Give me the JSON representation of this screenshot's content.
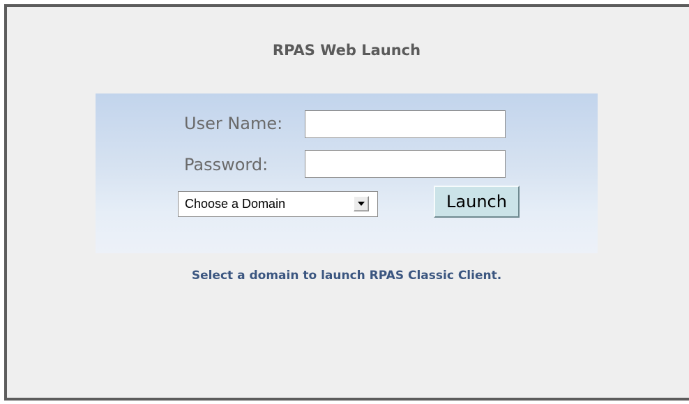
{
  "page": {
    "title": "RPAS Web Launch",
    "hint": "Select a domain to launch RPAS Classic Client."
  },
  "form": {
    "user_label": "User Name:",
    "user_value": "",
    "password_label": "Password:",
    "password_value": "",
    "domain_selected": "Choose a Domain",
    "launch_label": "Launch"
  },
  "colors": {
    "frame_border": "#5c5c5c",
    "background": "#efefef",
    "panel_gradient_top": "#c2d4ec",
    "panel_gradient_bottom": "#edf1f8",
    "title_text": "#5a5a5a",
    "hint_text": "#3b5680",
    "launch_button": "#cbe3e8"
  },
  "icons": {
    "dropdown": "chevron-down-icon"
  }
}
